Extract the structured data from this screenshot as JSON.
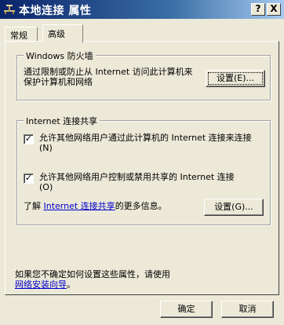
{
  "window": {
    "title": "本地连接 属性",
    "help_btn": "?",
    "close_btn": "X"
  },
  "tabs": [
    {
      "label": "常规",
      "active": false
    },
    {
      "label": "高级",
      "active": true
    }
  ],
  "firewall": {
    "legend": "Windows 防火墙",
    "description": "通过限制或防止从 Internet 访问此计算机来保护计算机和网络",
    "settings_button": "设置(E)..."
  },
  "ics": {
    "legend": "Internet 连接共享",
    "allow_connect_label": "允许其他网络用户通过此计算机的 Internet 连接来连接(N)",
    "allow_connect_checked": true,
    "allow_control_label": "允许其他网络用户控制或禁用共享的 Internet 连接(O)",
    "allow_control_checked": true,
    "more_info_prefix": "了解 ",
    "more_info_link": "Internet 连接共享",
    "more_info_suffix": "的更多信息。",
    "settings_button": "设置(G)..."
  },
  "footer": {
    "hint_text": "如果您不确定如何设置这些属性，请使用",
    "wizard_link": "网络安装向导",
    "hint_end": "。"
  },
  "buttons": {
    "ok": "确定",
    "cancel": "取消"
  },
  "check_glyph": "✓"
}
